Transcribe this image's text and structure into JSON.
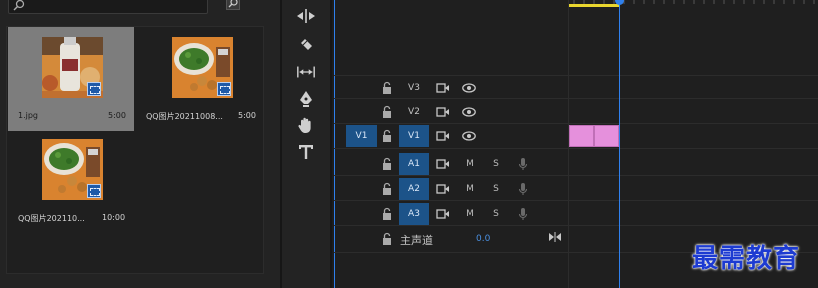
{
  "project_panel": {
    "media": [
      {
        "name": "1.jpg",
        "duration": "5:00",
        "selected": true
      },
      {
        "name": "QQ图片20211008...",
        "duration": "5:00",
        "selected": false
      },
      {
        "name": "QQ图片202110...",
        "duration": "10:00",
        "selected": false
      }
    ]
  },
  "tools": [
    "ripple-edit-icon",
    "razor-icon",
    "slip-icon",
    "pen-icon",
    "hand-icon",
    "type-icon"
  ],
  "timeline": {
    "video_tracks": [
      {
        "label": "V3",
        "source_patch": "",
        "targeted": false
      },
      {
        "label": "V2",
        "source_patch": "",
        "targeted": false
      },
      {
        "label": "V1",
        "source_patch": "V1",
        "targeted": true
      }
    ],
    "audio_tracks": [
      {
        "label": "A1",
        "mute": "M",
        "solo": "S"
      },
      {
        "label": "A2",
        "mute": "M",
        "solo": "S"
      },
      {
        "label": "A3",
        "mute": "M",
        "solo": "S"
      }
    ],
    "master": {
      "label": "主声道",
      "value": "0.0"
    },
    "clip_color": "#e590dc",
    "playhead_color": "#2f80ed"
  },
  "watermark": "最需教育"
}
